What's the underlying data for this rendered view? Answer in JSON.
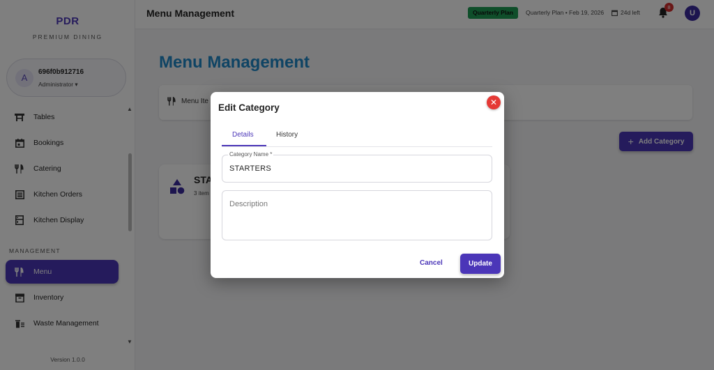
{
  "brand": {
    "name": "PDR",
    "tagline": "PREMIUM DINING"
  },
  "user": {
    "initial": "A",
    "name": "696f0b912716",
    "role": "Administrator ▾"
  },
  "sidebar": {
    "items": [
      {
        "label": "Tables",
        "icon": "table-icon"
      },
      {
        "label": "Bookings",
        "icon": "calendar-icon"
      },
      {
        "label": "Catering",
        "icon": "cutlery-icon"
      },
      {
        "label": "Kitchen Orders",
        "icon": "list-icon"
      },
      {
        "label": "Kitchen Display",
        "icon": "display-icon"
      }
    ],
    "section_label": "MANAGEMENT",
    "management_items": [
      {
        "label": "Menu",
        "icon": "cutlery-icon",
        "active": true
      },
      {
        "label": "Inventory",
        "icon": "inventory-icon"
      },
      {
        "label": "Waste Management",
        "icon": "trash-icon"
      }
    ],
    "version": "Version 1.0.0"
  },
  "header": {
    "title": "Menu Management",
    "plan_badge": "Quarterly Plan",
    "plan_text": "Quarterly Plan • Feb 19, 2026",
    "days_left": "24d left",
    "notification_count": "8",
    "avatar_initial": "U"
  },
  "main": {
    "title": "Menu Management",
    "tab_label": "Menu Ite",
    "add_button": "Add Category",
    "category": {
      "name": "STA",
      "count": "3 item"
    }
  },
  "modal": {
    "title": "Edit Category",
    "tabs": [
      "Details",
      "History"
    ],
    "name_label": "Category Name *",
    "name_value": "STARTERS",
    "description_placeholder": "Description",
    "cancel_label": "Cancel",
    "update_label": "Update"
  },
  "colors": {
    "primary": "#4b36b8",
    "title_blue": "#1e88c9",
    "plan_green": "#1f9d55",
    "close_red": "#e53935"
  }
}
